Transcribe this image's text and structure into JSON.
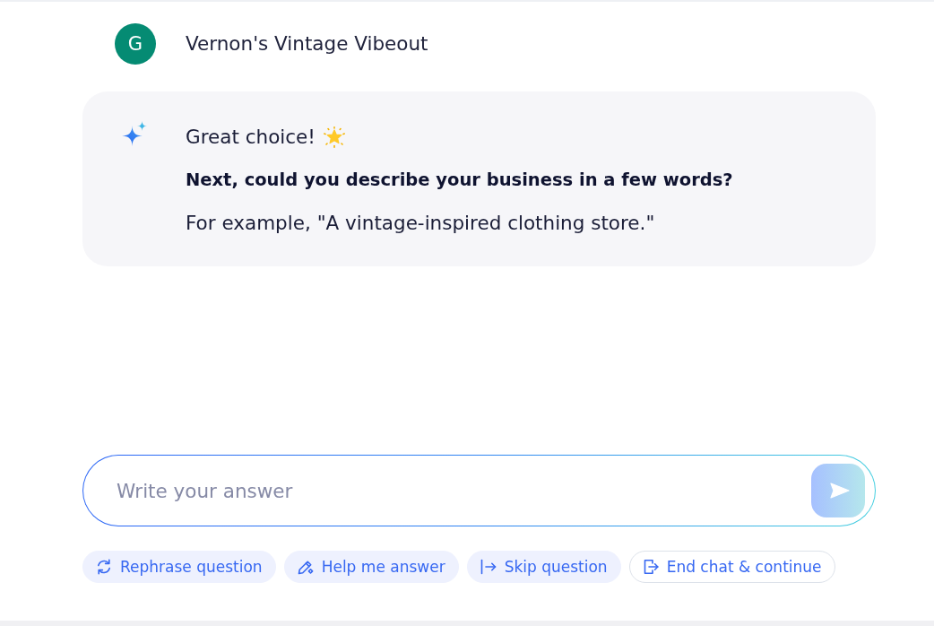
{
  "conversation": [
    {
      "kind": "user",
      "avatar": "G",
      "text": "Vernon's Vintage Vibeout"
    },
    {
      "kind": "assistant",
      "lines": [
        {
          "kind": "greeting",
          "text": "Great choice!"
        },
        {
          "kind": "question",
          "text": "Next, could you describe your business in a few words?"
        },
        {
          "kind": "example",
          "text": "For example, \"A vintage-inspired clothing store.\""
        }
      ]
    }
  ],
  "composer": {
    "placeholder": "Write your answer"
  },
  "suggestions": [
    {
      "kind": "rephrase",
      "label": "Rephrase question"
    },
    {
      "kind": "help",
      "label": "Help me answer"
    },
    {
      "kind": "skip",
      "label": "Skip question"
    },
    {
      "kind": "end",
      "label": "End chat & continue"
    }
  ]
}
